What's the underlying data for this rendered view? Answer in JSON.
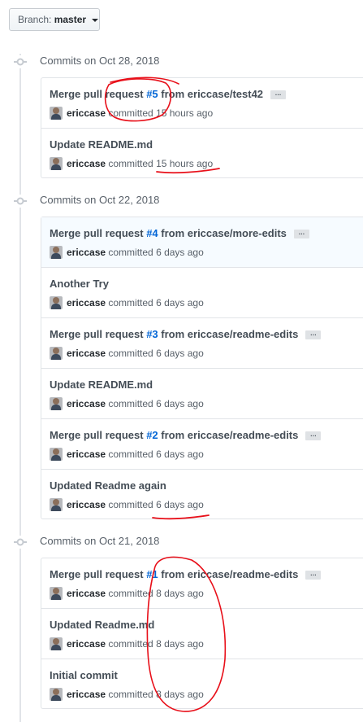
{
  "branch": {
    "label": "Branch:",
    "value": "master"
  },
  "groups": [
    {
      "title": "Commits on Oct 28, 2018",
      "commits": [
        {
          "msg_prefix": "Merge pull request ",
          "pr": "#5",
          "msg_suffix": " from ericcase/test42",
          "ellipsis": "…",
          "author": "ericcase",
          "verb": " committed ",
          "time": "15 hours ago"
        },
        {
          "msg_prefix": "Update README.md",
          "pr": "",
          "msg_suffix": "",
          "ellipsis": "",
          "author": "ericcase",
          "verb": " committed ",
          "time": "15 hours ago"
        }
      ]
    },
    {
      "title": "Commits on Oct 22, 2018",
      "commits": [
        {
          "msg_prefix": "Merge pull request ",
          "pr": "#4",
          "msg_suffix": " from ericcase/more-edits",
          "ellipsis": "…",
          "author": "ericcase",
          "verb": " committed ",
          "time": "6 days ago"
        },
        {
          "msg_prefix": "Another Try",
          "pr": "",
          "msg_suffix": "",
          "ellipsis": "",
          "author": "ericcase",
          "verb": " committed ",
          "time": "6 days ago"
        },
        {
          "msg_prefix": "Merge pull request ",
          "pr": "#3",
          "msg_suffix": " from ericcase/readme-edits",
          "ellipsis": "…",
          "author": "ericcase",
          "verb": " committed ",
          "time": "6 days ago"
        },
        {
          "msg_prefix": "Update README.md",
          "pr": "",
          "msg_suffix": "",
          "ellipsis": "",
          "author": "ericcase",
          "verb": " committed ",
          "time": "6 days ago"
        },
        {
          "msg_prefix": "Merge pull request ",
          "pr": "#2",
          "msg_suffix": " from ericcase/readme-edits",
          "ellipsis": "…",
          "author": "ericcase",
          "verb": " committed ",
          "time": "6 days ago"
        },
        {
          "msg_prefix": "Updated Readme again",
          "pr": "",
          "msg_suffix": "",
          "ellipsis": "",
          "author": "ericcase",
          "verb": " committed ",
          "time": "6 days ago"
        }
      ]
    },
    {
      "title": "Commits on Oct 21, 2018",
      "commits": [
        {
          "msg_prefix": "Merge pull request ",
          "pr": "#1",
          "msg_suffix": " from ericcase/readme-edits",
          "ellipsis": "…",
          "author": "ericcase",
          "verb": " committed ",
          "time": "8 days ago"
        },
        {
          "msg_prefix": "Updated Readme.md",
          "pr": "",
          "msg_suffix": "",
          "ellipsis": "",
          "author": "ericcase",
          "verb": " committed ",
          "time": "8 days ago"
        },
        {
          "msg_prefix": "Initial commit",
          "pr": "",
          "msg_suffix": "",
          "ellipsis": "",
          "author": "ericcase",
          "verb": " committed ",
          "time": "8 days ago"
        }
      ]
    }
  ],
  "colors": {
    "link": "#0366d6",
    "annotation": "#e8101a",
    "muted": "#586069"
  }
}
